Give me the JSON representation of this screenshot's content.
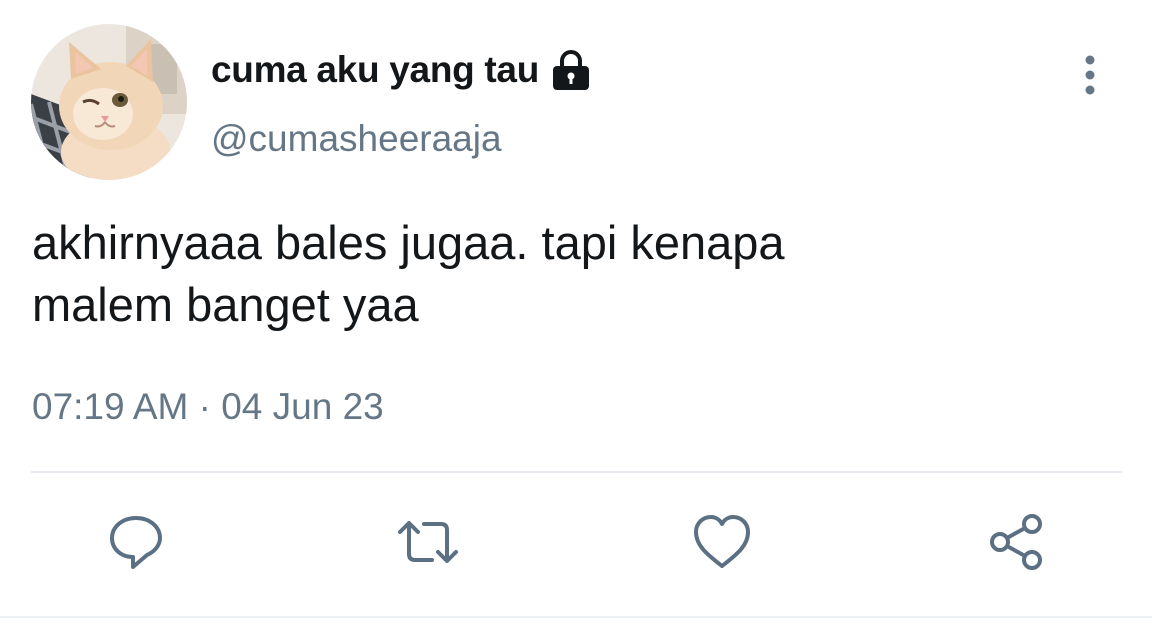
{
  "tweet": {
    "display_name": "cuma aku yang tau",
    "handle": "@cumasheeraaja",
    "protected_icon": "lock-icon",
    "text_lines": [
      "akhirnyaaa bales jugaa. tapi kenapa",
      "malem banget yaa"
    ],
    "timestamp": "07:19 AM · 04 Jun 23"
  },
  "actions": [
    {
      "name": "reply",
      "icon": "reply-icon"
    },
    {
      "name": "retweet",
      "icon": "retweet-icon"
    },
    {
      "name": "like",
      "icon": "heart-icon"
    },
    {
      "name": "share",
      "icon": "share-icon"
    }
  ],
  "more_menu_icon": "more-vertical-icon",
  "colors": {
    "text_primary": "#14171a",
    "text_secondary": "#657786",
    "icon": "#5b7083",
    "divider": "#e6ecf0"
  }
}
